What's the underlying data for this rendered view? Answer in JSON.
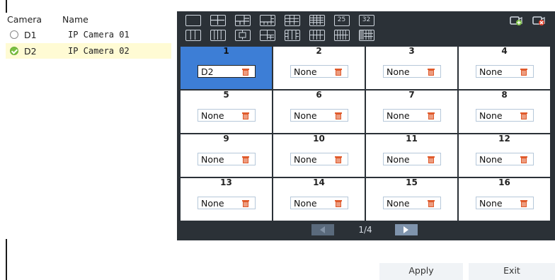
{
  "camera_list": {
    "headers": {
      "camera": "Camera",
      "name": "Name"
    },
    "rows": [
      {
        "id": "D1",
        "name": "IP Camera 01",
        "selected": false
      },
      {
        "id": "D2",
        "name": "IP Camera 02",
        "selected": true
      }
    ]
  },
  "layout_buttons": {
    "row1": [
      "1",
      "4",
      "6",
      "8",
      "9",
      "16",
      "25",
      "32"
    ],
    "row1_text": {
      "25": "25",
      "32": "32"
    },
    "row2_count": 8
  },
  "top_icons": [
    "add-camera-icon",
    "remove-camera-icon"
  ],
  "grid_cells": [
    {
      "num": "1",
      "value": "D2"
    },
    {
      "num": "2",
      "value": "None"
    },
    {
      "num": "3",
      "value": "None"
    },
    {
      "num": "4",
      "value": "None"
    },
    {
      "num": "5",
      "value": "None"
    },
    {
      "num": "6",
      "value": "None"
    },
    {
      "num": "7",
      "value": "None"
    },
    {
      "num": "8",
      "value": "None"
    },
    {
      "num": "9",
      "value": "None"
    },
    {
      "num": "10",
      "value": "None"
    },
    {
      "num": "11",
      "value": "None"
    },
    {
      "num": "12",
      "value": "None"
    },
    {
      "num": "13",
      "value": "None"
    },
    {
      "num": "14",
      "value": "None"
    },
    {
      "num": "15",
      "value": "None"
    },
    {
      "num": "16",
      "value": "None"
    }
  ],
  "pager": {
    "label": "1/4"
  },
  "actions": {
    "apply": "Apply",
    "exit": "Exit"
  },
  "colors": {
    "panel": "#2b3137",
    "selected_cell": "#3d7ed6",
    "accent_green": "#7bc043",
    "trash": "#e05a2b"
  }
}
